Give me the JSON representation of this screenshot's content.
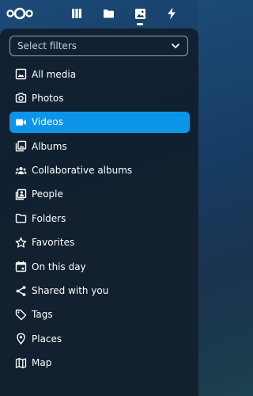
{
  "header": {
    "logo_icon": "nextcloud-logo-icon",
    "apps": [
      {
        "name": "dashboard",
        "icon": "dashboard-icon"
      },
      {
        "name": "files",
        "icon": "folder-icon"
      },
      {
        "name": "photos",
        "icon": "image-icon",
        "active": true
      },
      {
        "name": "activity",
        "icon": "lightning-icon"
      }
    ]
  },
  "filters": {
    "placeholder": "Select filters"
  },
  "nav": {
    "items": [
      {
        "label": "All media",
        "icon": "image-icon"
      },
      {
        "label": "Photos",
        "icon": "camera-icon"
      },
      {
        "label": "Videos",
        "icon": "video-icon",
        "active": true
      },
      {
        "label": "Albums",
        "icon": "albums-icon"
      },
      {
        "label": "Collaborative albums",
        "icon": "people-group-icon"
      },
      {
        "label": "People",
        "icon": "person-card-icon"
      },
      {
        "label": "Folders",
        "icon": "folder-icon"
      },
      {
        "label": "Favorites",
        "icon": "star-icon"
      },
      {
        "label": "On this day",
        "icon": "calendar-icon"
      },
      {
        "label": "Shared with you",
        "icon": "share-icon"
      },
      {
        "label": "Tags",
        "icon": "tag-icon"
      },
      {
        "label": "Places",
        "icon": "map-pin-icon"
      },
      {
        "label": "Map",
        "icon": "map-icon"
      }
    ]
  },
  "colors": {
    "accent": "#0c95e8",
    "panel": "#111e2c",
    "text": "#ffffff"
  }
}
